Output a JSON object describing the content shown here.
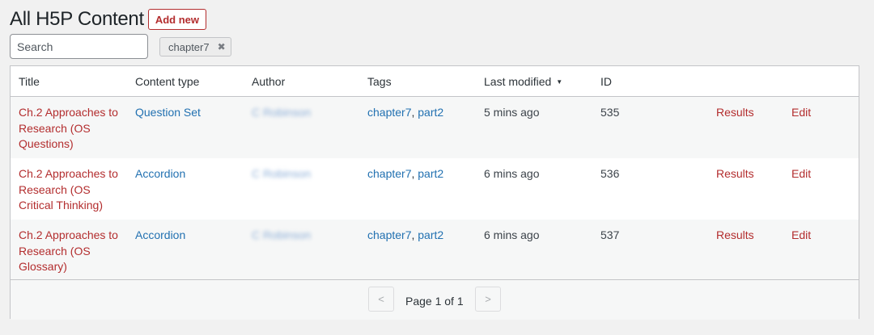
{
  "header": {
    "title": "All H5P Content",
    "add_new_label": "Add new"
  },
  "search": {
    "placeholder": "Search",
    "value": ""
  },
  "filter": {
    "tag": "chapter7",
    "remove_symbol": "✖"
  },
  "table": {
    "columns": [
      "Title",
      "Content type",
      "Author",
      "Tags",
      "Last modified",
      "ID"
    ],
    "sort_indicator": "▼",
    "rows": [
      {
        "title": "Ch.2 Approaches to Research (OS Questions)",
        "content_type": "Question Set",
        "author": "C Robinson",
        "tags": [
          "chapter7",
          "part2"
        ],
        "last_modified": "5 mins ago",
        "id": "535",
        "results": "Results",
        "edit": "Edit"
      },
      {
        "title": "Ch.2 Approaches to Research (OS Critical Thinking)",
        "content_type": "Accordion",
        "author": "C Robinson",
        "tags": [
          "chapter7",
          "part2"
        ],
        "last_modified": "6 mins ago",
        "id": "536",
        "results": "Results",
        "edit": "Edit"
      },
      {
        "title": "Ch.2 Approaches to Research (OS Glossary)",
        "content_type": "Accordion",
        "author": "C Robinson",
        "tags": [
          "chapter7",
          "part2"
        ],
        "last_modified": "6 mins ago",
        "id": "537",
        "results": "Results",
        "edit": "Edit"
      }
    ]
  },
  "pagination": {
    "prev": "<",
    "next": ">",
    "text": "Page 1 of 1"
  },
  "colors": {
    "accent_red": "#b32d2e",
    "link_blue": "#2271b1"
  }
}
